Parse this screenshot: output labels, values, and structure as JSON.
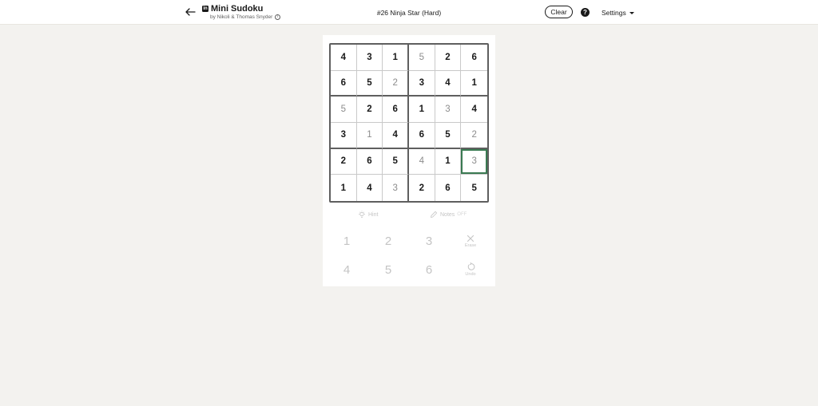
{
  "header": {
    "back_icon": "arrow-left-icon",
    "logo_icon": "linkedin-logo-icon",
    "logo_glyph": "in",
    "app_title": "Mini Sudoku",
    "byline": "by Nikoli & Thomas Snyder",
    "info_icon": "info-icon",
    "info_glyph": "i",
    "puzzle_title": "#26 Ninja Star (Hard)",
    "clear_label": "Clear",
    "help_icon": "question-circle-icon",
    "help_glyph": "?",
    "settings_label": "Settings"
  },
  "board": {
    "selected_cell": {
      "row": 4,
      "col": 5
    },
    "accent_color": "#3a7a52",
    "rows": [
      [
        {
          "v": "4",
          "given": true
        },
        {
          "v": "3",
          "given": true
        },
        {
          "v": "1",
          "given": true
        },
        {
          "v": "5",
          "given": false
        },
        {
          "v": "2",
          "given": true
        },
        {
          "v": "6",
          "given": true
        }
      ],
      [
        {
          "v": "6",
          "given": true
        },
        {
          "v": "5",
          "given": true
        },
        {
          "v": "2",
          "given": false
        },
        {
          "v": "3",
          "given": true
        },
        {
          "v": "4",
          "given": true
        },
        {
          "v": "1",
          "given": true
        }
      ],
      [
        {
          "v": "5",
          "given": false
        },
        {
          "v": "2",
          "given": true
        },
        {
          "v": "6",
          "given": true
        },
        {
          "v": "1",
          "given": true
        },
        {
          "v": "3",
          "given": false
        },
        {
          "v": "4",
          "given": true
        }
      ],
      [
        {
          "v": "3",
          "given": true
        },
        {
          "v": "1",
          "given": false
        },
        {
          "v": "4",
          "given": true
        },
        {
          "v": "6",
          "given": true
        },
        {
          "v": "5",
          "given": true
        },
        {
          "v": "2",
          "given": false
        }
      ],
      [
        {
          "v": "2",
          "given": true
        },
        {
          "v": "6",
          "given": true
        },
        {
          "v": "5",
          "given": true
        },
        {
          "v": "4",
          "given": false
        },
        {
          "v": "1",
          "given": true
        },
        {
          "v": "3",
          "given": false
        }
      ],
      [
        {
          "v": "1",
          "given": true
        },
        {
          "v": "4",
          "given": true
        },
        {
          "v": "3",
          "given": false
        },
        {
          "v": "2",
          "given": true
        },
        {
          "v": "6",
          "given": true
        },
        {
          "v": "5",
          "given": true
        }
      ]
    ]
  },
  "tools": {
    "hint_label": "Hint",
    "hint_icon": "lightbulb-icon",
    "notes_label": "Notes",
    "notes_icon": "pencil-icon",
    "notes_state": "OFF"
  },
  "numpad": {
    "keys": [
      "1",
      "2",
      "3",
      "4",
      "5",
      "6"
    ],
    "erase_label": "Erase",
    "erase_icon": "x-icon",
    "undo_label": "Undo",
    "undo_icon": "undo-icon"
  }
}
